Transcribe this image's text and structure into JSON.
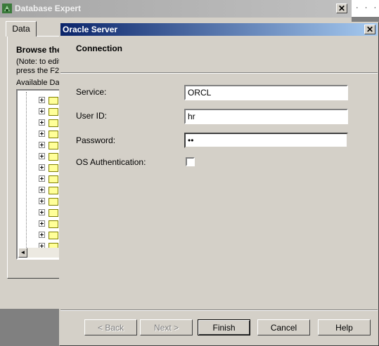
{
  "background_window": {
    "title": "Database Expert",
    "close_symbol": "✕",
    "tab_label": "Data",
    "browse_heading": "Browse the",
    "note_line1": "(Note: to edit",
    "note_line2": "press the F2",
    "available_label": "Available Da",
    "tree_folder_count": 14,
    "scroll_left_symbol": "◄"
  },
  "top_right": {
    "dots": "· · ·"
  },
  "dialog": {
    "title": "Oracle Server",
    "close_symbol": "✕",
    "section_heading": "Connection",
    "fields": {
      "service": {
        "label": "Service:",
        "value": "ORCL"
      },
      "user_id": {
        "label": "User ID:",
        "value": "hr"
      },
      "password": {
        "label": "Password:",
        "value": "••"
      },
      "os_auth": {
        "label": "OS Authentication:",
        "checked": false
      }
    },
    "buttons": {
      "back": "< Back",
      "next": "Next >",
      "finish": "Finish",
      "cancel": "Cancel",
      "help": "Help"
    }
  },
  "colors": {
    "titlebar_active": "#0a246a",
    "window_face": "#d4d0c8",
    "desktop": "#808080"
  }
}
